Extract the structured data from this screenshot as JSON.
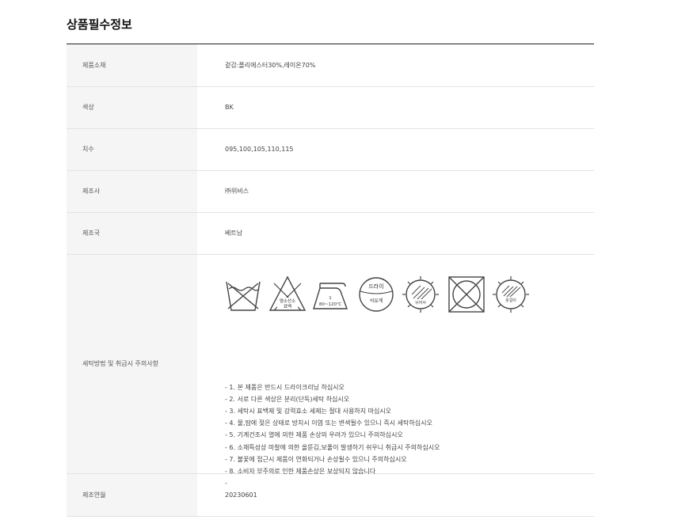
{
  "title": "상품필수정보",
  "rows": [
    {
      "label": "제품소재",
      "value": "겉감:폴리에스터30%,레이온70%"
    },
    {
      "label": "색상",
      "value": "BK"
    },
    {
      "label": "치수",
      "value": "095,100,105,110,115"
    },
    {
      "label": "제조사",
      "value": "㈜위비스"
    },
    {
      "label": "제조국",
      "value": "베트남"
    }
  ],
  "care": {
    "label": "세탁방법 및 취급시 주의사항",
    "symbols": [
      {
        "icon": "no-wash-icon"
      },
      {
        "icon": "no-bleach-icon",
        "text1": "염소산소",
        "text2": "표백"
      },
      {
        "icon": "iron-icon",
        "text1": "1",
        "text2": "80~120℃"
      },
      {
        "icon": "dry-clean-icon",
        "text1": "드라이",
        "text2": "석유계"
      },
      {
        "icon": "shade-dry-icon",
        "text1": "뉘어서"
      },
      {
        "icon": "no-tumble-dry-icon"
      },
      {
        "icon": "shade-hang-icon",
        "text1": "옷걸이"
      }
    ],
    "notes": [
      "- 1. 본 제품은 반드시 드라이크리닝 하십시오",
      "- 2. 서로 다른 색상은 분리(단독)세탁 하십시오",
      "- 3. 세탁시 표백제 및 강력효소 세제는 절대 사용하지 마십시오",
      "- 4. 물,땀에 젖은 상태로 방치시 이염 또는 변색될수 있으니 즉시 세탁하십시오",
      "- 5. 기계건조시 열에 의한 제품 손상의 우려가 있으니 주의하십시오",
      "- 6. 소재특성상 마찰에 의한 올뜯김,보풀이 발생하기 쉬우니 취급시 주의하십시오",
      "- 7. 불꽃에 접근시 제품이 연화되거나 손상될수 있으니 주의하십시오",
      "- 8. 소비자 부주의로 인한 제품손상은 보상되지 않습니다",
      "-"
    ]
  },
  "last_row": {
    "label": "제조연월",
    "value": "20230601"
  }
}
